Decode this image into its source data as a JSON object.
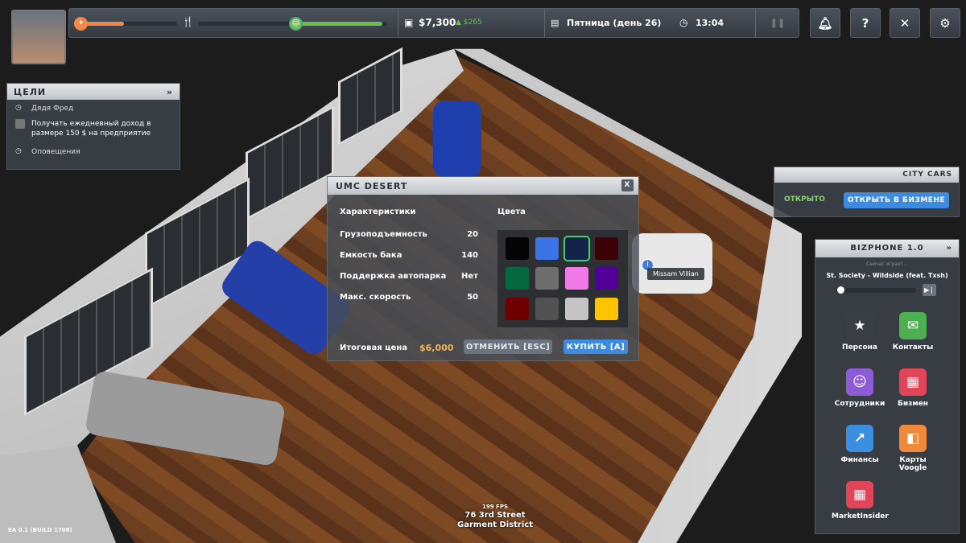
{
  "hud": {
    "money": "$7,300",
    "income": "▲ $265",
    "day": "Пятница (день 26)",
    "time": "13:04",
    "energy": 0.45,
    "hunger": 0.0,
    "happiness": 0.95
  },
  "goals": {
    "title": "ЦЕЛИ",
    "section1": "Дядя Фред",
    "task": "Получать ежедневный доход в размере 150 $ на предприятие",
    "section2": "Оповещения"
  },
  "dialog": {
    "title": "UMC DESERT",
    "close": "X",
    "specs_title": "Характеристики",
    "colors_title": "Цвета",
    "specs": [
      {
        "label": "Грузоподъемность",
        "value": "20"
      },
      {
        "label": "Емкость бака",
        "value": "140"
      },
      {
        "label": "Поддержка автопарка",
        "value": "Нет"
      },
      {
        "label": "Макс. скорость",
        "value": "50"
      }
    ],
    "colors": [
      "#050505",
      "#3b74e6",
      "#13234a",
      "#3d0206",
      "#06683e",
      "#6e6e6e",
      "#ef7ae8",
      "#520099",
      "#6f0000",
      "#525252",
      "#c4c4c4",
      "#ffc300"
    ],
    "selected_color": 2,
    "price_label": "Итоговая цена",
    "price": "$6,000",
    "cancel": "ОТМЕНИТЬ [ESC]",
    "buy": "КУПИТЬ [A]"
  },
  "business": {
    "name": "CITY CARS",
    "status": "ОТКРЫТО",
    "open_btn": "ОТКРЫТЬ В БИЗМЕНЕ"
  },
  "phone": {
    "title": "BIZPHONE 1.0",
    "now_playing": "Сейчас играет...",
    "track": "St. Society - Wildside (feat. Txsh)",
    "progress": 0.02,
    "apps": [
      {
        "label": "Персона",
        "icon": "★",
        "color": "#3a3f45"
      },
      {
        "label": "Контакты",
        "icon": "✉",
        "color": "#4caf50"
      },
      {
        "label": "Сотрудники",
        "icon": "☺",
        "color": "#8e5bd6"
      },
      {
        "label": "Бизмен",
        "icon": "▦",
        "color": "#e0455a"
      },
      {
        "label": "Финансы",
        "icon": "↗",
        "color": "#3a8fe0"
      },
      {
        "label": "Карты Voogle",
        "icon": "◧",
        "color": "#f08a3a"
      },
      {
        "label": "MarketInsider",
        "icon": "▦",
        "color": "#e0455a"
      }
    ]
  },
  "npc_label": "Missam Villian",
  "footer": {
    "fps": "199 FPS",
    "street": "76 3rd Street",
    "district": "Garment District",
    "build": "EA 0.1 (BUILD 1708)"
  }
}
